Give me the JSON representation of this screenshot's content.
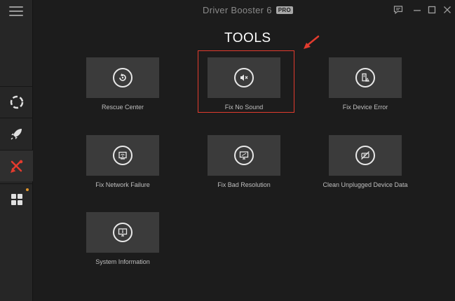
{
  "app": {
    "title": "Driver Booster 6",
    "badge": "PRO"
  },
  "page": {
    "title": "TOOLS"
  },
  "sidebar": {
    "items": [
      {
        "name": "scan",
        "icon": "lifebuoy-icon"
      },
      {
        "name": "boost",
        "icon": "rocket-icon"
      },
      {
        "name": "tools",
        "icon": "tools-icon",
        "active": true
      },
      {
        "name": "action-center",
        "icon": "apps-grid-icon",
        "notification": true
      }
    ]
  },
  "tools": [
    {
      "label": "Rescue Center",
      "icon": "restore-icon"
    },
    {
      "label": "Fix No Sound",
      "icon": "speaker-mute-icon",
      "highlighted": true
    },
    {
      "label": "Fix Device Error",
      "icon": "device-warning-icon"
    },
    {
      "label": "Fix Network Failure",
      "icon": "network-icon"
    },
    {
      "label": "Fix Bad Resolution",
      "icon": "monitor-resolution-icon"
    },
    {
      "label": "Clean Unplugged Device Data",
      "icon": "unplugged-device-icon"
    },
    {
      "label": "System Information",
      "icon": "system-info-icon"
    }
  ],
  "colors": {
    "accent": "#e23b2e",
    "tile": "#3b3b3b",
    "background": "#1c1c1c",
    "sidebar": "#262626"
  }
}
